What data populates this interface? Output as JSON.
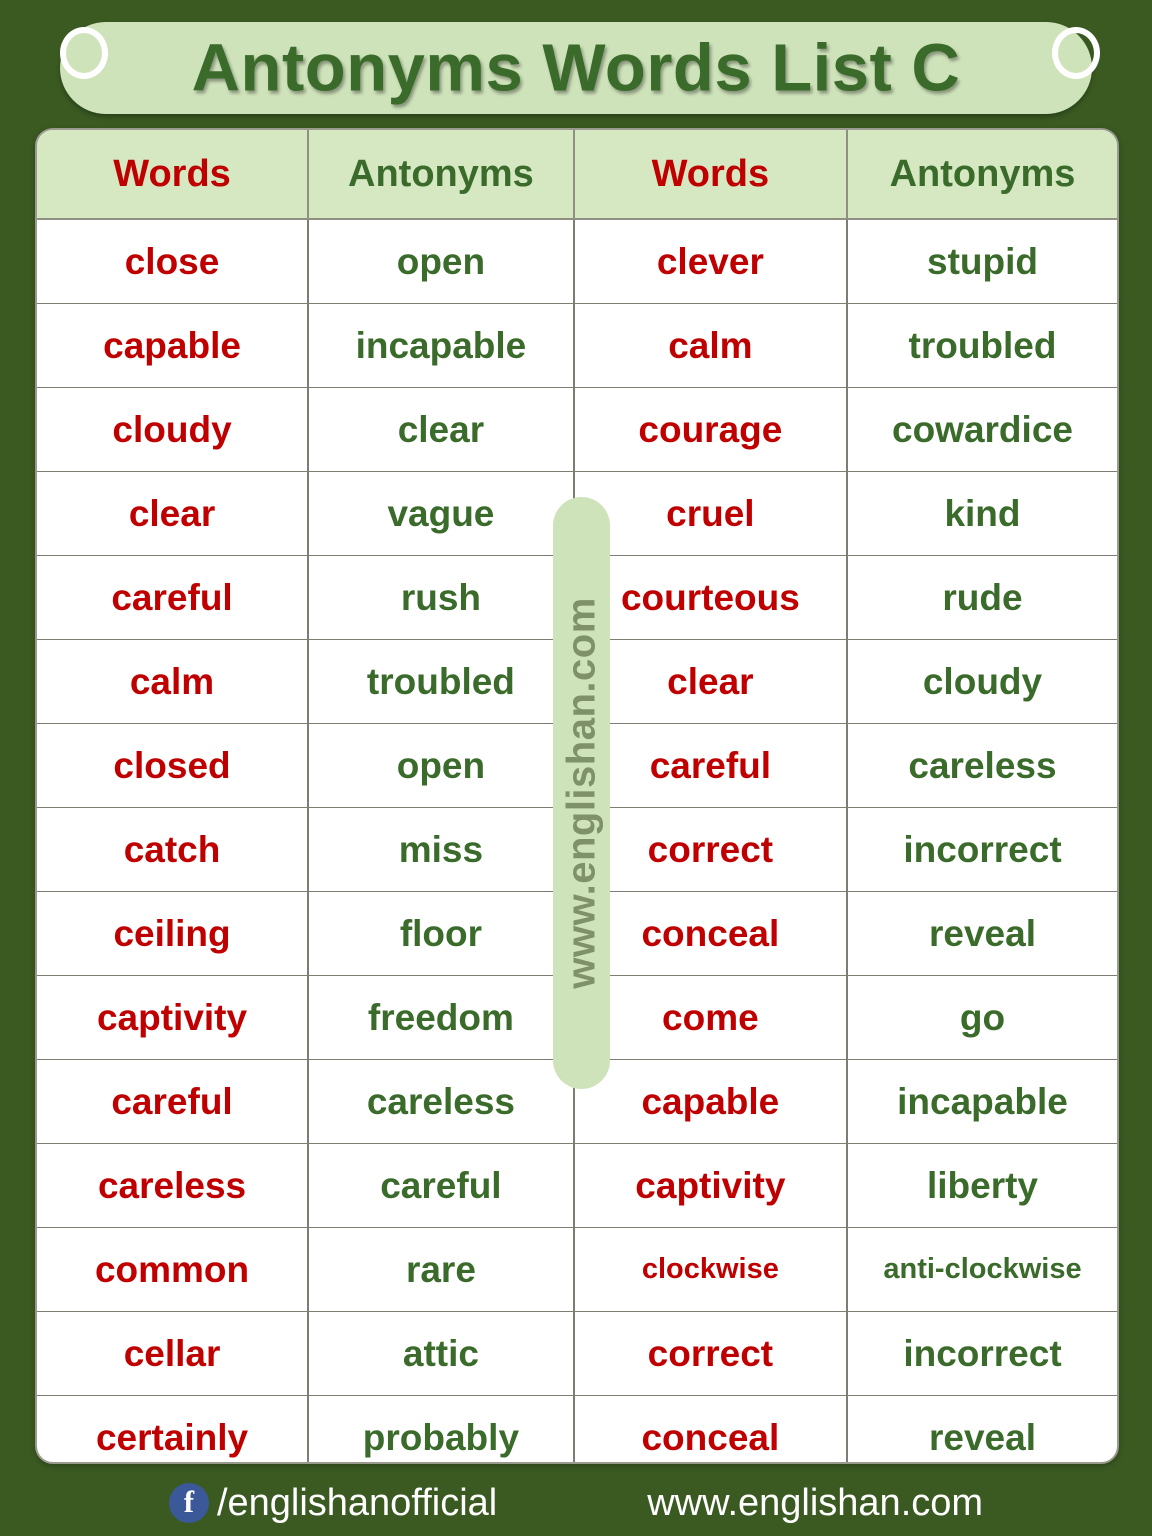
{
  "page": {
    "title": "Antonyms Words  List C",
    "background_color": "#3a5a22",
    "word_color": "#c00000",
    "antonym_color": "#3a6b2b",
    "banner_color": "#cfe3bb"
  },
  "table": {
    "headers": [
      "Words",
      "Antonyms",
      "Words",
      "Antonyms"
    ],
    "rows": [
      {
        "word_left": "close",
        "antonym_left": "open",
        "word_right": "clever",
        "antonym_right": "stupid"
      },
      {
        "word_left": "capable",
        "antonym_left": "incapable",
        "word_right": "calm",
        "antonym_right": "troubled"
      },
      {
        "word_left": "cloudy",
        "antonym_left": "clear",
        "word_right": "courage",
        "antonym_right": "cowardice"
      },
      {
        "word_left": "clear",
        "antonym_left": "vague",
        "word_right": "cruel",
        "antonym_right": "kind"
      },
      {
        "word_left": "careful",
        "antonym_left": "rush",
        "word_right": "courteous",
        "antonym_right": "rude"
      },
      {
        "word_left": "calm",
        "antonym_left": "troubled",
        "word_right": "clear",
        "antonym_right": "cloudy"
      },
      {
        "word_left": "closed",
        "antonym_left": "open",
        "word_right": "careful",
        "antonym_right": "careless"
      },
      {
        "word_left": "catch",
        "antonym_left": "miss",
        "word_right": "correct",
        "antonym_right": "incorrect"
      },
      {
        "word_left": "ceiling",
        "antonym_left": "floor",
        "word_right": "conceal",
        "antonym_right": "reveal"
      },
      {
        "word_left": "captivity",
        "antonym_left": "freedom",
        "word_right": "come",
        "antonym_right": "go"
      },
      {
        "word_left": "careful",
        "antonym_left": "careless",
        "word_right": "capable",
        "antonym_right": "incapable"
      },
      {
        "word_left": "careless",
        "antonym_left": "careful",
        "word_right": "captivity",
        "antonym_right": "liberty"
      },
      {
        "word_left": "common",
        "antonym_left": "rare",
        "word_right": "clockwise",
        "antonym_right": "anti-clockwise",
        "small_right": true
      },
      {
        "word_left": "cellar",
        "antonym_left": "attic",
        "word_right": "correct",
        "antonym_right": "incorrect"
      },
      {
        "word_left": "certainly",
        "antonym_left": "probably",
        "word_right": "conceal",
        "antonym_right": "reveal"
      }
    ]
  },
  "watermark": {
    "text": "www.englishan.com"
  },
  "footer": {
    "facebook_icon_letter": "f",
    "facebook_handle": "/englishanofficial",
    "website": "www.englishan.com"
  }
}
